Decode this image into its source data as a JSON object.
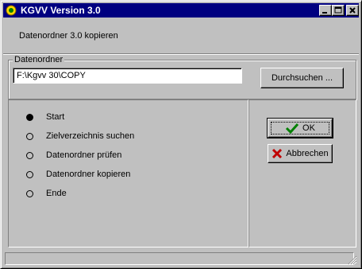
{
  "window": {
    "title": "KGVV Version 3.0"
  },
  "header": {
    "text": "Datenordner 3.0 kopieren"
  },
  "folder_group": {
    "label": "Datenordner",
    "path_value": "F:\\Kgvv 30\\COPY",
    "browse_label": "Durchsuchen ..."
  },
  "steps": [
    {
      "label": "Start",
      "active": true
    },
    {
      "label": "Zielverzeichnis suchen",
      "active": false
    },
    {
      "label": "Datenordner prüfen",
      "active": false
    },
    {
      "label": "Datenordner kopieren",
      "active": false
    },
    {
      "label": "Ende",
      "active": false
    }
  ],
  "buttons": {
    "ok_label": "OK",
    "cancel_label": "Abbrechen"
  },
  "colors": {
    "titlebar": "#000080",
    "ok_check": "#008000",
    "cancel_x": "#c00000"
  }
}
